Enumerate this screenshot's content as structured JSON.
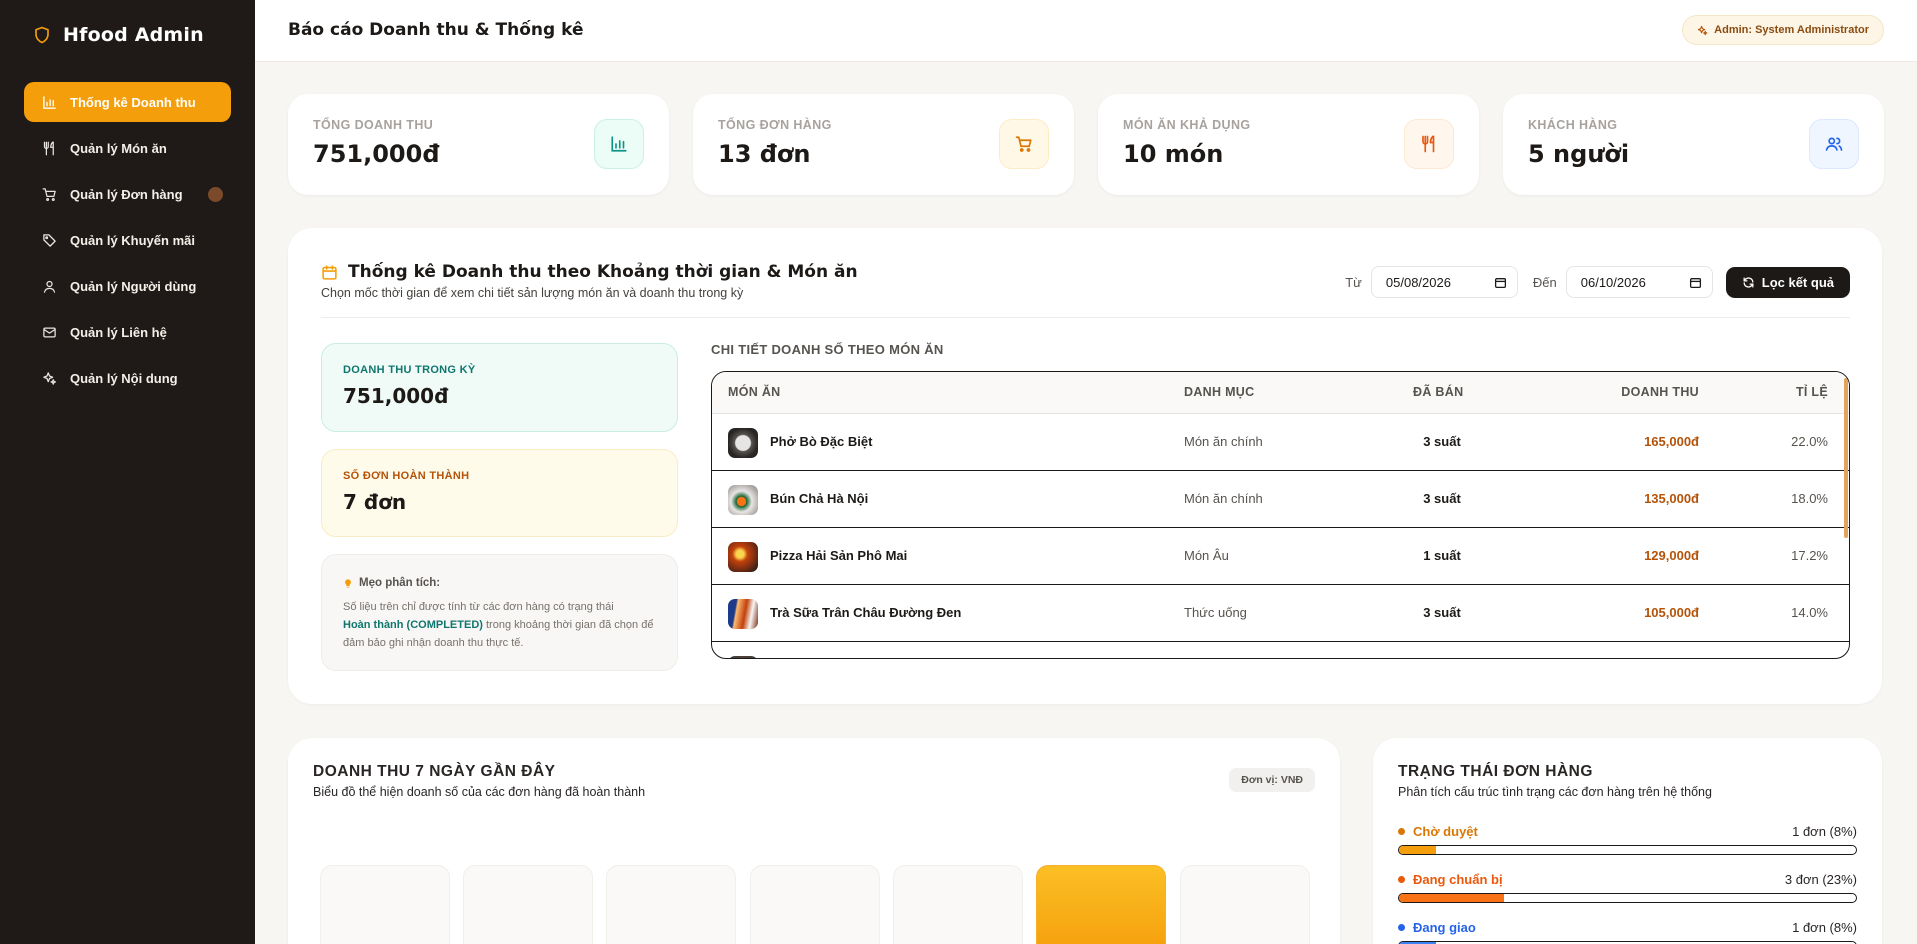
{
  "brand": {
    "name": "Hfood Admin"
  },
  "sidebar": {
    "items": [
      {
        "label": "Thống kê Doanh thu",
        "icon": "bar-chart-icon",
        "active": true
      },
      {
        "label": "Quản lý Món ăn",
        "icon": "utensils-icon"
      },
      {
        "label": "Quản lý Đơn hàng",
        "icon": "cart-icon"
      },
      {
        "label": "Quản lý Khuyến mãi",
        "icon": "tag-icon"
      },
      {
        "label": "Quản lý Người dùng",
        "icon": "users-icon"
      },
      {
        "label": "Quản lý Liên hệ",
        "icon": "mail-icon"
      },
      {
        "label": "Quản lý Nội dung",
        "icon": "sparkles-icon"
      }
    ]
  },
  "header": {
    "title": "Báo cáo Doanh thu & Thống kê",
    "admin_badge": "Admin: System Administrator"
  },
  "stats": [
    {
      "label": "TỔNG DOANH THU",
      "value": "751,000đ",
      "icon": "bar-chart-icon",
      "color": "#0d9488"
    },
    {
      "label": "TỔNG ĐƠN HÀNG",
      "value": "13 đơn",
      "icon": "cart-icon",
      "color": "#d97706"
    },
    {
      "label": "MÓN ĂN KHẢ DỤNG",
      "value": "10 món",
      "icon": "utensils-icon",
      "color": "#ea580c"
    },
    {
      "label": "KHÁCH HÀNG",
      "value": "5 người",
      "icon": "users-icon",
      "color": "#2563eb"
    }
  ],
  "filter": {
    "title": "Thống kê Doanh thu theo Khoảng thời gian & Món ăn",
    "subtitle": "Chọn mốc thời gian để xem chi tiết sản lượng món ăn và doanh thu trong kỳ",
    "from_label": "Từ",
    "from_value": "05/08/2026",
    "to_label": "Đến",
    "to_value": "06/10/2026",
    "button": "Lọc kết quả"
  },
  "period": {
    "revenue_label": "DOANH THU TRONG KỲ",
    "revenue_value": "751,000đ",
    "orders_label": "SỐ ĐƠN HOÀN THÀNH",
    "orders_value": "7 đơn",
    "tip_title": "Mẹo phân tích:",
    "tip_before": "Số liệu trên chỉ được tính từ các đơn hàng có trạng thái",
    "tip_bold": "Hoàn thành (COMPLETED)",
    "tip_after": "trong khoảng thời gian đã chọn để đảm bảo ghi nhận doanh thu thực tế."
  },
  "dish_table": {
    "heading": "CHI TIẾT DOANH SỐ THEO MÓN ĂN",
    "columns": [
      "MÓN ĂN",
      "DANH MỤC",
      "ĐÃ BÁN",
      "DOANH THU",
      "TỈ LỆ"
    ],
    "rows": [
      {
        "name": "Phở Bò Đặc Biệt",
        "category": "Món ăn chính",
        "sold": "3 suất",
        "revenue": "165,000đ",
        "percent": "22.0%"
      },
      {
        "name": "Bún Chả Hà Nội",
        "category": "Món ăn chính",
        "sold": "3 suất",
        "revenue": "135,000đ",
        "percent": "18.0%"
      },
      {
        "name": "Pizza Hải Sản Phô Mai",
        "category": "Món Âu",
        "sold": "1 suất",
        "revenue": "129,000đ",
        "percent": "17.2%"
      },
      {
        "name": "Trà Sữa Trân Châu Đường Đen",
        "category": "Thức uống",
        "sold": "3 suất",
        "revenue": "105,000đ",
        "percent": "14.0%"
      }
    ]
  },
  "weekly_chart": {
    "title": "DOANH THU 7 NGÀY GẦN ĐÂY",
    "subtitle": "Biểu đồ thể hiện doanh số của các đơn hàng đã hoàn thành",
    "unit": "Đơn vị: VNĐ"
  },
  "status": {
    "title": "TRẠNG THÁI ĐƠN HÀNG",
    "subtitle": "Phân tích cấu trúc tình trạng các đơn hàng trên hệ thống",
    "items": [
      {
        "label": "Chờ duyệt",
        "value": "1 đơn (8%)",
        "percent": 8,
        "color": "#d97706"
      },
      {
        "label": "Đang chuẩn bị",
        "value": "3 đơn (23%)",
        "percent": 23,
        "color": "#ea580c"
      },
      {
        "label": "Đang giao",
        "value": "1 đơn (8%)",
        "percent": 8,
        "color": "#2563eb"
      }
    ]
  }
}
